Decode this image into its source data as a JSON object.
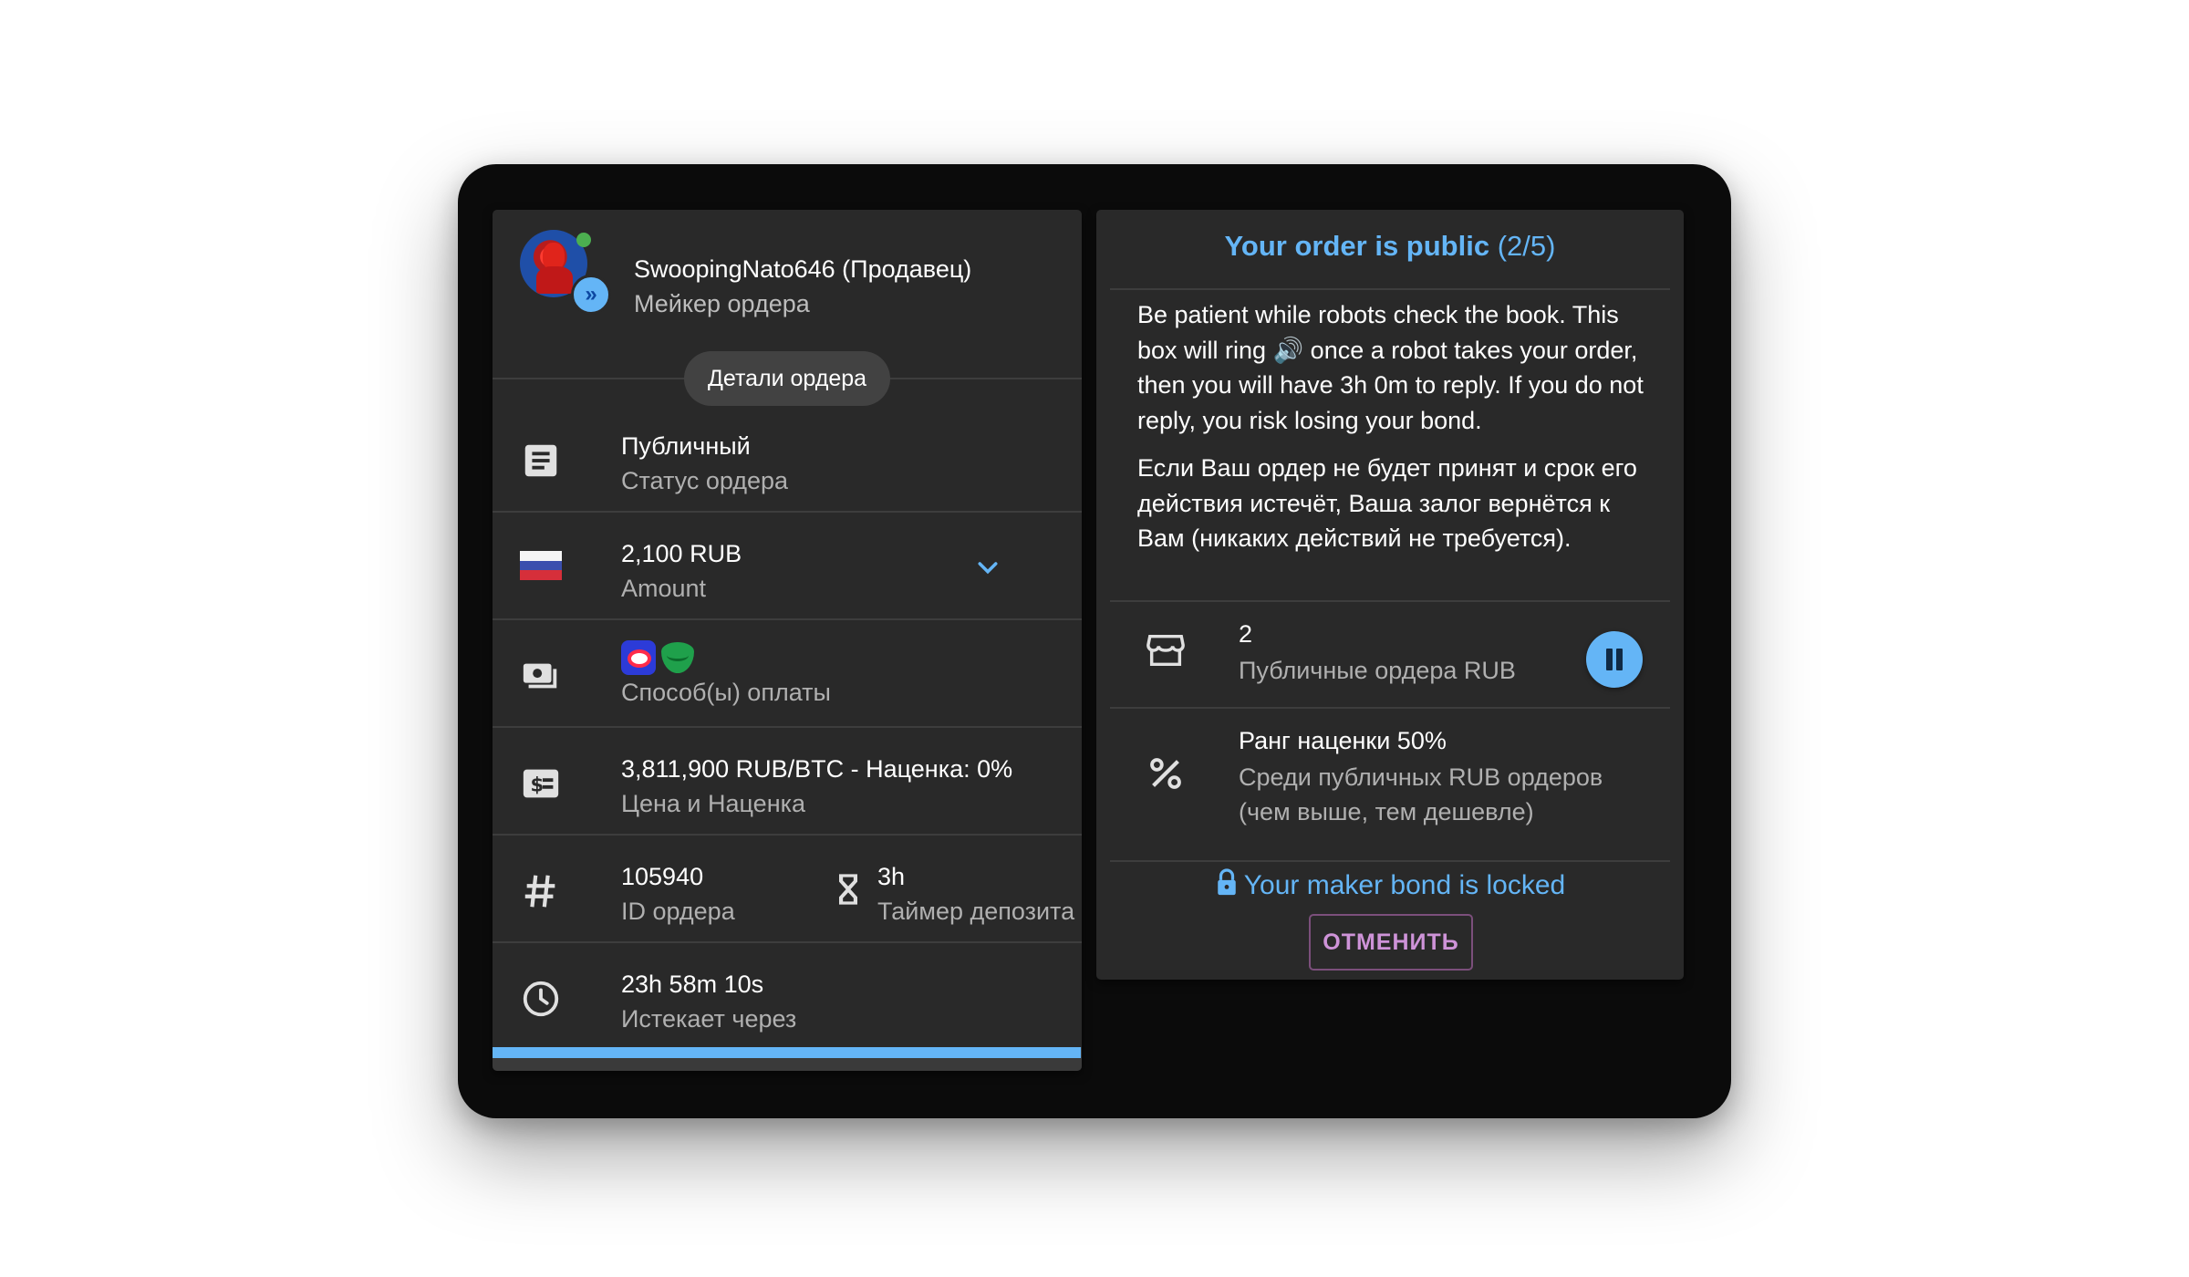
{
  "maker": {
    "name": "SwoopingNato646 (Продавец)",
    "role": "Мейкер ордера"
  },
  "details_chip": "Детали ордера",
  "rows": {
    "status": {
      "primary": "Публичный",
      "secondary": "Статус ордера",
      "icon": "article-icon"
    },
    "amount": {
      "primary": "2,100 RUB",
      "secondary": "Amount",
      "icon": "russia-flag"
    },
    "payment": {
      "secondary": "Способ(ы) оплаты",
      "icons": [
        "mts-bank-icon",
        "sberbank-icon"
      ]
    },
    "price": {
      "primary": "3,811,900 RUB/BTC - Наценка: 0%",
      "secondary": "Цена и Наценка",
      "icon": "price-icon"
    },
    "order_id": {
      "primary": "105940",
      "secondary": "ID ордера",
      "icon": "hash-icon"
    },
    "deposit_timer": {
      "primary": "3h",
      "secondary": "Таймер депозита",
      "icon": "hourglass-icon"
    },
    "expires": {
      "primary": "23h 58m 10s",
      "secondary": "Истекает через",
      "icon": "clock-icon"
    }
  },
  "expiry_progress": 0.999,
  "status_panel": {
    "title": "Your order is public",
    "step": "(2/5)",
    "message1": "Be patient while robots check the book. This box will ring 🔊 once a robot takes your order, then you will have 3h 0m to reply. If you do not reply, you risk losing your bond.",
    "message2": "Если Ваш ордер не будет принят и срок его действия истечёт, Ваша залог вернётся к Вам (никаких действий не требуется).",
    "public_orders": {
      "primary": "2",
      "secondary": "Публичные ордера RUB"
    },
    "premium_rank": {
      "primary": "Ранг наценки 50%",
      "secondary1": "Среди публичных RUB ордеров",
      "secondary2": "(чем выше, тем дешевле)"
    },
    "bond_text": "Your maker bond is locked",
    "cancel_label": "ОТМЕНИТЬ"
  },
  "colors": {
    "accent": "#64b5f6",
    "panel": "#292929",
    "cancel": "#ce93d8",
    "online": "#4caf50"
  }
}
